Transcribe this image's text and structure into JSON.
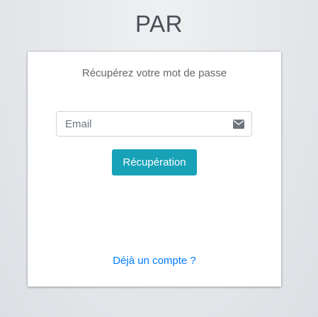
{
  "app": {
    "logo_text": "PAR"
  },
  "card": {
    "message": "Récupérez votre mot de passe",
    "email": {
      "placeholder": "Email",
      "value": ""
    },
    "submit_label": "Récupération",
    "login_link": "Déjà un compte ?"
  },
  "icons": {
    "email_icon": "envelope-icon"
  },
  "colors": {
    "button": "#17a2b8",
    "link": "#007bff",
    "page_background": "#e4e7ea"
  }
}
